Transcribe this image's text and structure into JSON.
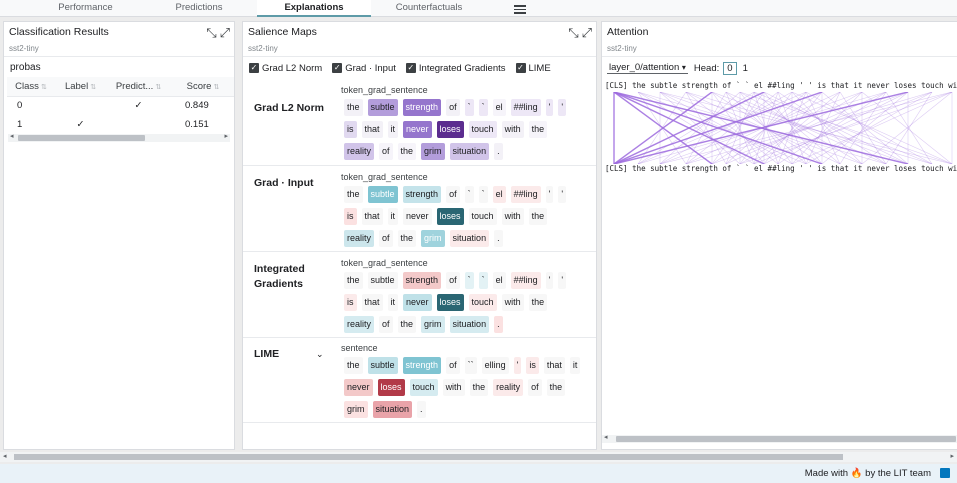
{
  "tabs": [
    {
      "label": "Performance",
      "active": false
    },
    {
      "label": "Predictions",
      "active": false
    },
    {
      "label": "Explanations",
      "active": true
    },
    {
      "label": "Counterfactuals",
      "active": false
    }
  ],
  "classification": {
    "title": "Classification Results",
    "dataset": "sst2-tiny",
    "probas_label": "probas",
    "columns": [
      "Class",
      "Label",
      "Predict...",
      "Score"
    ],
    "rows": [
      {
        "class": "0",
        "label": "",
        "predicted": "✓",
        "score": "0.849"
      },
      {
        "class": "1",
        "label": "✓",
        "predicted": "",
        "score": "0.151"
      }
    ]
  },
  "saliency": {
    "title": "Salience Maps",
    "dataset": "sst2-tiny",
    "method_checkboxes": [
      "Grad L2 Norm",
      "Grad · Input",
      "Integrated Gradients",
      "LIME"
    ],
    "methods": [
      {
        "name": "Grad L2 Norm",
        "field": "token_grad_sentence",
        "tokens": [
          {
            "t": "the",
            "bg": "#f3f1f7",
            "fg": "#202124"
          },
          {
            "t": "subtle",
            "bg": "#b39ddb",
            "fg": "#202124"
          },
          {
            "t": "strength",
            "bg": "#9575cd",
            "fg": "#ffffff"
          },
          {
            "t": "of",
            "bg": "#f3f1f7",
            "fg": "#202124"
          },
          {
            "t": "`",
            "bg": "#ede7f6",
            "fg": "#202124"
          },
          {
            "t": "`",
            "bg": "#ede7f6",
            "fg": "#202124"
          },
          {
            "t": "el",
            "bg": "#f6f4fa",
            "fg": "#202124"
          },
          {
            "t": "##ling",
            "bg": "#ede7f6",
            "fg": "#202124"
          },
          {
            "t": "'",
            "bg": "#ede7f6",
            "fg": "#202124"
          },
          {
            "t": "'",
            "bg": "#ede7f6",
            "fg": "#202124"
          },
          {
            "t": "is",
            "bg": "#e1d9f0",
            "fg": "#202124"
          },
          {
            "t": "that",
            "bg": "#f3f1f7",
            "fg": "#202124"
          },
          {
            "t": "it",
            "bg": "#f3f1f7",
            "fg": "#202124"
          },
          {
            "t": "never",
            "bg": "#9575cd",
            "fg": "#ffffff"
          },
          {
            "t": "loses",
            "bg": "#5b2c8f",
            "fg": "#ffffff"
          },
          {
            "t": "touch",
            "bg": "#ede7f6",
            "fg": "#202124"
          },
          {
            "t": "with",
            "bg": "#f3f1f7",
            "fg": "#202124"
          },
          {
            "t": "the",
            "bg": "#f6f4fa",
            "fg": "#202124"
          },
          {
            "t": "reality",
            "bg": "#d1c4e9",
            "fg": "#202124"
          },
          {
            "t": "of",
            "bg": "#f6f4fa",
            "fg": "#202124"
          },
          {
            "t": "the",
            "bg": "#f6f4fa",
            "fg": "#202124"
          },
          {
            "t": "grim",
            "bg": "#b39ddb",
            "fg": "#202124"
          },
          {
            "t": "situation",
            "bg": "#d1c4e9",
            "fg": "#202124"
          },
          {
            "t": ".",
            "bg": "#f3f1f7",
            "fg": "#202124"
          }
        ]
      },
      {
        "name": "Grad · Input",
        "field": "token_grad_sentence",
        "tokens": [
          {
            "t": "the",
            "bg": "#f7f7f7",
            "fg": "#202124"
          },
          {
            "t": "subtle",
            "bg": "#7fc4d2",
            "fg": "#ffffff"
          },
          {
            "t": "strength",
            "bg": "#c4e3ea",
            "fg": "#202124"
          },
          {
            "t": "of",
            "bg": "#f7f7f7",
            "fg": "#202124"
          },
          {
            "t": "`",
            "bg": "#f7f7f7",
            "fg": "#202124"
          },
          {
            "t": "`",
            "bg": "#f7f7f7",
            "fg": "#202124"
          },
          {
            "t": "el",
            "bg": "#fbeaea",
            "fg": "#202124"
          },
          {
            "t": "##ling",
            "bg": "#fbeaea",
            "fg": "#202124"
          },
          {
            "t": "'",
            "bg": "#f7f7f7",
            "fg": "#202124"
          },
          {
            "t": "'",
            "bg": "#f7f7f7",
            "fg": "#202124"
          },
          {
            "t": "is",
            "bg": "#fbe1e1",
            "fg": "#202124"
          },
          {
            "t": "that",
            "bg": "#f7f7f7",
            "fg": "#202124"
          },
          {
            "t": "it",
            "bg": "#f7f7f7",
            "fg": "#202124"
          },
          {
            "t": "never",
            "bg": "#f7f7f7",
            "fg": "#202124"
          },
          {
            "t": "loses",
            "bg": "#2a6673",
            "fg": "#ffffff"
          },
          {
            "t": "touch",
            "bg": "#f7f7f7",
            "fg": "#202124"
          },
          {
            "t": "with",
            "bg": "#f7f7f7",
            "fg": "#202124"
          },
          {
            "t": "the",
            "bg": "#f7f7f7",
            "fg": "#202124"
          },
          {
            "t": "reality",
            "bg": "#cce6ec",
            "fg": "#202124"
          },
          {
            "t": "of",
            "bg": "#f7f7f7",
            "fg": "#202124"
          },
          {
            "t": "the",
            "bg": "#f7f7f7",
            "fg": "#202124"
          },
          {
            "t": "grim",
            "bg": "#9fd3dd",
            "fg": "#ffffff"
          },
          {
            "t": "situation",
            "bg": "#fbeaea",
            "fg": "#202124"
          },
          {
            "t": ".",
            "bg": "#f7f7f7",
            "fg": "#202124"
          }
        ]
      },
      {
        "name": "Integrated Gradients",
        "field": "token_grad_sentence",
        "tokens": [
          {
            "t": "the",
            "bg": "#f7f7f7",
            "fg": "#202124"
          },
          {
            "t": "subtle",
            "bg": "#f7f7f7",
            "fg": "#202124"
          },
          {
            "t": "strength",
            "bg": "#f3c9c9",
            "fg": "#202124"
          },
          {
            "t": "of",
            "bg": "#f7f7f7",
            "fg": "#202124"
          },
          {
            "t": "`",
            "bg": "#e3f2f5",
            "fg": "#202124"
          },
          {
            "t": "`",
            "bg": "#e3f2f5",
            "fg": "#202124"
          },
          {
            "t": "el",
            "bg": "#f7f7f7",
            "fg": "#202124"
          },
          {
            "t": "##ling",
            "bg": "#fbeaea",
            "fg": "#202124"
          },
          {
            "t": "'",
            "bg": "#f7f7f7",
            "fg": "#202124"
          },
          {
            "t": "'",
            "bg": "#f7f7f7",
            "fg": "#202124"
          },
          {
            "t": "is",
            "bg": "#fbeaea",
            "fg": "#202124"
          },
          {
            "t": "that",
            "bg": "#f7f7f7",
            "fg": "#202124"
          },
          {
            "t": "it",
            "bg": "#f7f7f7",
            "fg": "#202124"
          },
          {
            "t": "never",
            "bg": "#bfe1e8",
            "fg": "#202124"
          },
          {
            "t": "loses",
            "bg": "#2a6673",
            "fg": "#ffffff"
          },
          {
            "t": "touch",
            "bg": "#fbeaea",
            "fg": "#202124"
          },
          {
            "t": "with",
            "bg": "#f7f7f7",
            "fg": "#202124"
          },
          {
            "t": "the",
            "bg": "#f7f7f7",
            "fg": "#202124"
          },
          {
            "t": "reality",
            "bg": "#d5ebf0",
            "fg": "#202124"
          },
          {
            "t": "of",
            "bg": "#f7f7f7",
            "fg": "#202124"
          },
          {
            "t": "the",
            "bg": "#f7f7f7",
            "fg": "#202124"
          },
          {
            "t": "grim",
            "bg": "#d5ebf0",
            "fg": "#202124"
          },
          {
            "t": "situation",
            "bg": "#d5ebf0",
            "fg": "#202124"
          },
          {
            "t": ".",
            "bg": "#fbe1e1",
            "fg": "#202124"
          }
        ]
      },
      {
        "name": "LIME",
        "field": "sentence",
        "tokens": [
          {
            "t": "the",
            "bg": "#f7f7f7",
            "fg": "#202124"
          },
          {
            "t": "subtle",
            "bg": "#bfe1e8",
            "fg": "#202124"
          },
          {
            "t": "strength",
            "bg": "#7fc4d2",
            "fg": "#ffffff"
          },
          {
            "t": "of",
            "bg": "#f7f7f7",
            "fg": "#202124"
          },
          {
            "t": "``",
            "bg": "#f7f7f7",
            "fg": "#202124"
          },
          {
            "t": "elling",
            "bg": "#f7f7f7",
            "fg": "#202124"
          },
          {
            "t": "'",
            "bg": "#fbeaea",
            "fg": "#202124"
          },
          {
            "t": "is",
            "bg": "#fbeaea",
            "fg": "#202124"
          },
          {
            "t": "that",
            "bg": "#f7f7f7",
            "fg": "#202124"
          },
          {
            "t": "it",
            "bg": "#f7f7f7",
            "fg": "#202124"
          },
          {
            "t": "never",
            "bg": "#f3c9c9",
            "fg": "#202124"
          },
          {
            "t": "loses",
            "bg": "#b23a48",
            "fg": "#ffffff"
          },
          {
            "t": "touch",
            "bg": "#d5ebf0",
            "fg": "#202124"
          },
          {
            "t": "with",
            "bg": "#f7f7f7",
            "fg": "#202124"
          },
          {
            "t": "the",
            "bg": "#f7f7f7",
            "fg": "#202124"
          },
          {
            "t": "reality",
            "bg": "#fbeaea",
            "fg": "#202124"
          },
          {
            "t": "of",
            "bg": "#f7f7f7",
            "fg": "#202124"
          },
          {
            "t": "the",
            "bg": "#f7f7f7",
            "fg": "#202124"
          },
          {
            "t": "grim",
            "bg": "#fbe1e1",
            "fg": "#202124"
          },
          {
            "t": "situation",
            "bg": "#e9a3a9",
            "fg": "#202124"
          },
          {
            "t": ".",
            "bg": "#f7f7f7",
            "fg": "#202124"
          }
        ]
      }
    ]
  },
  "attention": {
    "title": "Attention",
    "dataset": "sst2-tiny",
    "layer_selected": "layer_0/attention",
    "head_label": "Head:",
    "heads": [
      "0",
      "1"
    ],
    "tokens_line": "[CLS] the subtle strength of ` ` el ##ling ' ' is that it never loses touch with",
    "line_color": "#9c6ade"
  },
  "footer": {
    "made_with": "Made with 🔥 by the LIT team"
  }
}
